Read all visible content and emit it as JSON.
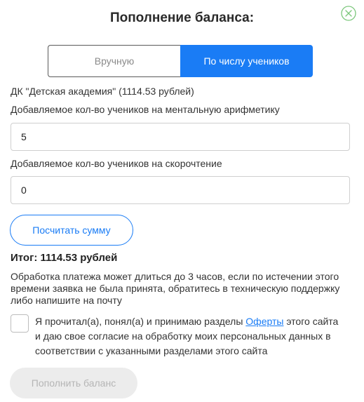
{
  "modal": {
    "title": "Пополнение баланса:",
    "close_icon": "close-circle-icon"
  },
  "tabs": {
    "manual_label": "Вручную",
    "by_students_label": "По числу учеников",
    "active": "by_students"
  },
  "organization_line": "ДК \"Детская академия\" (1114.53 рублей)",
  "mental_arithmetic": {
    "label": "Добавляемое кол-во учеников на ментальную арифметику",
    "value": "5"
  },
  "speed_reading": {
    "label": "Добавляемое кол-во учеников на скорочтение",
    "value": "0"
  },
  "calculate_label": "Посчитать сумму",
  "total_text": "Итог: 1114.53 рублей",
  "notice": "Обработка платежа может длиться до 3 часов, если по истечении этого времени заявка не была принята, обратитесь в техническую поддержку либо напишите на почту",
  "agreement": {
    "before": "Я прочитал(а), понял(а) и принимаю разделы ",
    "link": "Оферты",
    "after": " этого сайта и даю свое согласие на обработку моих персональных данных в соответствии с указанными разделами этого сайта",
    "checked": false
  },
  "submit_label": "Пополнить баланс",
  "colors": {
    "accent": "#1a7cf5",
    "close": "#7cc77c",
    "disabled_bg": "#ececec",
    "disabled_text": "#b5b5b5"
  }
}
